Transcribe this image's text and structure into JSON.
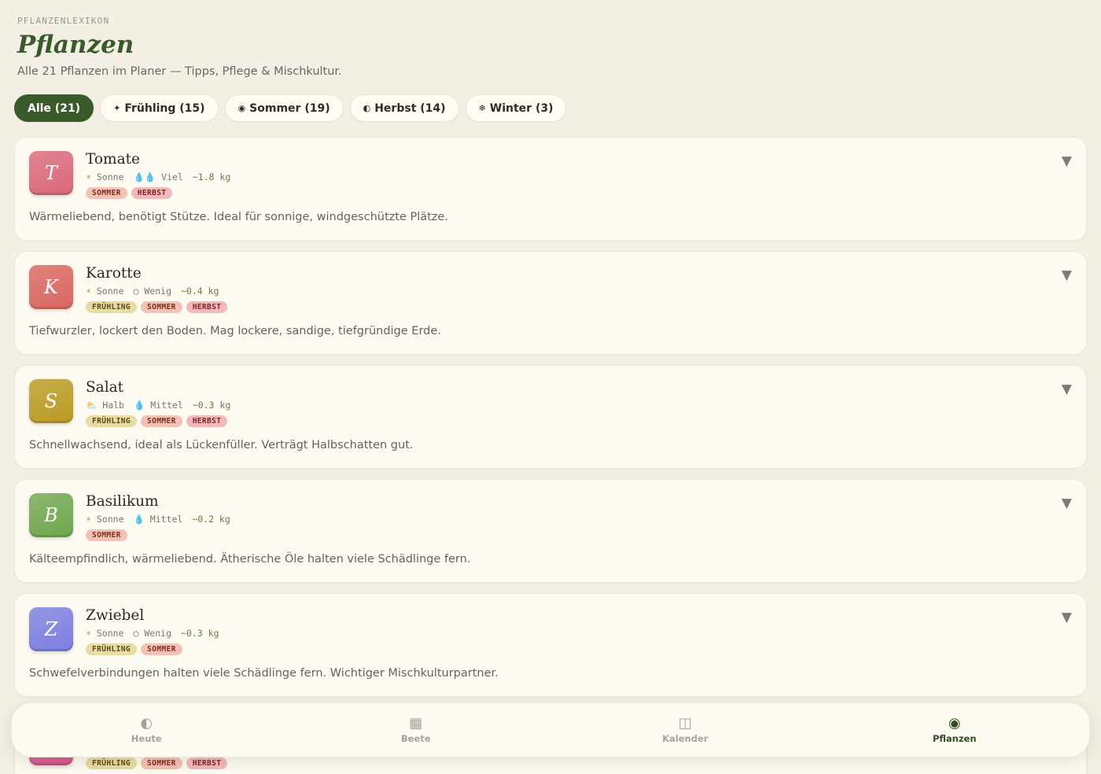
{
  "header": {
    "eyebrow": "PFLANZENLEXIKON",
    "title": "Pflanzen",
    "subtitle": "Alle 21 Pflanzen im Planer — Tipps, Pflege & Mischkultur."
  },
  "filters": [
    {
      "icon": "",
      "label": "Alle (21)",
      "active": true
    },
    {
      "icon": "✦",
      "label": "Frühling (15)"
    },
    {
      "icon": "◉",
      "label": "Sommer (19)"
    },
    {
      "icon": "◐",
      "label": "Herbst (14)"
    },
    {
      "icon": "❄",
      "label": "Winter (3)"
    }
  ],
  "plants": [
    {
      "letter": "T",
      "name": "Tomate",
      "color": "#d9677a",
      "sun_icon": "☀",
      "sun": "Sonne",
      "water_icon": "💧💧",
      "water": "Viel",
      "yield": "~1.8 kg",
      "tags": [
        "SOMMER",
        "HERBST"
      ],
      "desc": "Wärmeliebend, benötigt Stütze. Ideal für sonnige, windgeschützte Plätze."
    },
    {
      "letter": "K",
      "name": "Karotte",
      "color": "#d9655f",
      "sun_icon": "☀",
      "sun": "Sonne",
      "water_icon": "○",
      "water": "Wenig",
      "yield": "~0.4 kg",
      "tags": [
        "FRÜHLING",
        "SOMMER",
        "HERBST"
      ],
      "desc": "Tiefwurzler, lockert den Boden. Mag lockere, sandige, tiefgründige Erde."
    },
    {
      "letter": "S",
      "name": "Salat",
      "color": "#b99a24",
      "sun_icon": "⛅",
      "sun": "Halb",
      "water_icon": "💧",
      "water": "Mittel",
      "yield": "~0.3 kg",
      "tags": [
        "FRÜHLING",
        "SOMMER",
        "HERBST"
      ],
      "desc": "Schnellwachsend, ideal als Lückenfüller. Verträgt Halbschatten gut."
    },
    {
      "letter": "B",
      "name": "Basilikum",
      "color": "#6fa64e",
      "sun_icon": "☀",
      "sun": "Sonne",
      "water_icon": "💧",
      "water": "Mittel",
      "yield": "~0.2 kg",
      "tags": [
        "SOMMER"
      ],
      "desc": "Kälteempfindlich, wärmeliebend. Ätherische Öle halten viele Schädlinge fern."
    },
    {
      "letter": "Z",
      "name": "Zwiebel",
      "color": "#7b7ee0",
      "sun_icon": "☀",
      "sun": "Sonne",
      "water_icon": "○",
      "water": "Wenig",
      "yield": "~0.3 kg",
      "tags": [
        "FRÜHLING",
        "SOMMER"
      ],
      "desc": "Schwefelverbindungen halten viele Schädlinge fern. Wichtiger Mischkulturpartner."
    },
    {
      "letter": "",
      "name": "",
      "color": "#d4578f",
      "sun_icon": "",
      "sun": "",
      "water_icon": "",
      "water": "",
      "yield": "",
      "tags": [
        "FRÜHLING",
        "SOMMER",
        "HERBST"
      ],
      "desc": ""
    }
  ],
  "nav": [
    {
      "icon": "◐",
      "label": "Heute"
    },
    {
      "icon": "▦",
      "label": "Beete"
    },
    {
      "icon": "◫",
      "label": "Kalender"
    },
    {
      "icon": "◉",
      "label": "Pflanzen",
      "active": true
    }
  ]
}
